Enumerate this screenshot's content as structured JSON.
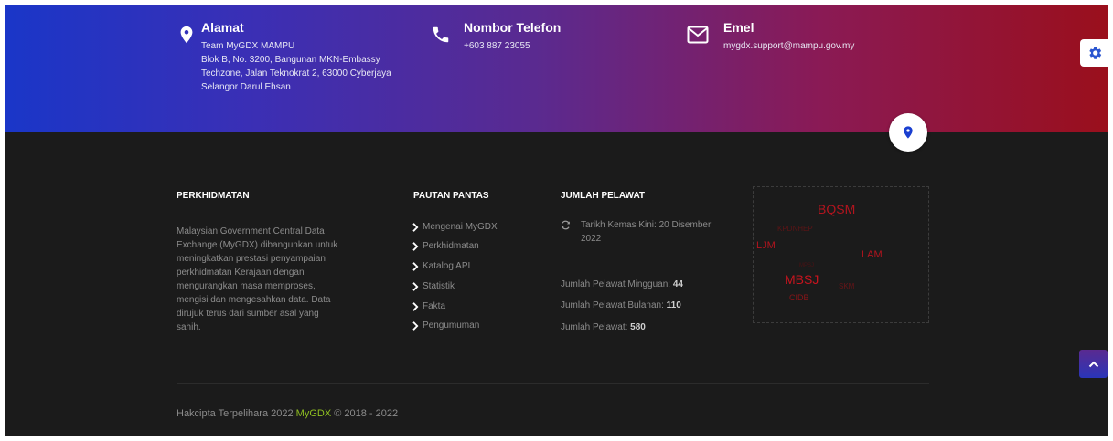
{
  "contacts": {
    "address": {
      "title": "Alamat",
      "lines": [
        "Team MyGDX MAMPU",
        "Blok B, No. 3200, Bangunan MKN-Embassy",
        "Techzone, Jalan Teknokrat 2, 63000 Cyberjaya",
        "Selangor Darul Ehsan"
      ]
    },
    "phone": {
      "title": "Nombor Telefon",
      "value": "+603 887 23055"
    },
    "email": {
      "title": "Emel",
      "value": "mygdx.support@mampu.gov.my"
    }
  },
  "services": {
    "heading": "PERKHIDMATAN",
    "lines": [
      "Malaysian Government Central Data",
      "Exchange (MyGDX) dibangunkan untuk",
      "meningkatkan prestasi penyampaian",
      "perkhidmatan Kerajaan dengan",
      "mengurangkan masa memproses,",
      "mengisi dan mengesahkan data. Data",
      "dirujuk terus dari sumber asal yang",
      "sahih."
    ]
  },
  "quick_links": {
    "heading": "PAUTAN PANTAS",
    "items": [
      "Mengenai MyGDX",
      "Perkhidmatan",
      "Katalog API",
      "Statistik",
      "Fakta",
      "Pengumuman"
    ]
  },
  "visitors": {
    "heading": "JUMLAH PELAWAT",
    "updated_line1": "Tarikh Kemas Kini: 20 Disember",
    "updated_line2": "2022",
    "weekly_label": "Jumlah Pelawat Mingguan:",
    "weekly_value": "44",
    "monthly_label": "Jumlah Pelawat Bulanan:",
    "monthly_value": "110",
    "total_label": "Jumlah Pelawat:",
    "total_value": "580"
  },
  "word_cloud": {
    "words": [
      "BQSM",
      "KPDNHEP",
      "LJM",
      "LAM",
      "MPSJ",
      "MBSJ",
      "SKM",
      "CIDB"
    ]
  },
  "footer": {
    "copyright_prefix": "Hakcipta Terpelihara 2022",
    "brand": "MyGDX",
    "copyright_suffix": "© 2018 - 2022"
  },
  "colors": {
    "band_start": "#1a36c8",
    "band_end": "#9a0f1c",
    "footer_bg": "#1b1b1b",
    "brand_green": "#8fbf21",
    "cloud_red": "#b3141e"
  },
  "icons": {
    "address": "map-marker-icon",
    "phone": "phone-icon",
    "email": "envelope-icon",
    "settings": "gear-icon",
    "map": "map-pin-icon",
    "refresh": "refresh-icon",
    "link": "chevron-right-icon",
    "scroll": "chevron-up-icon"
  }
}
